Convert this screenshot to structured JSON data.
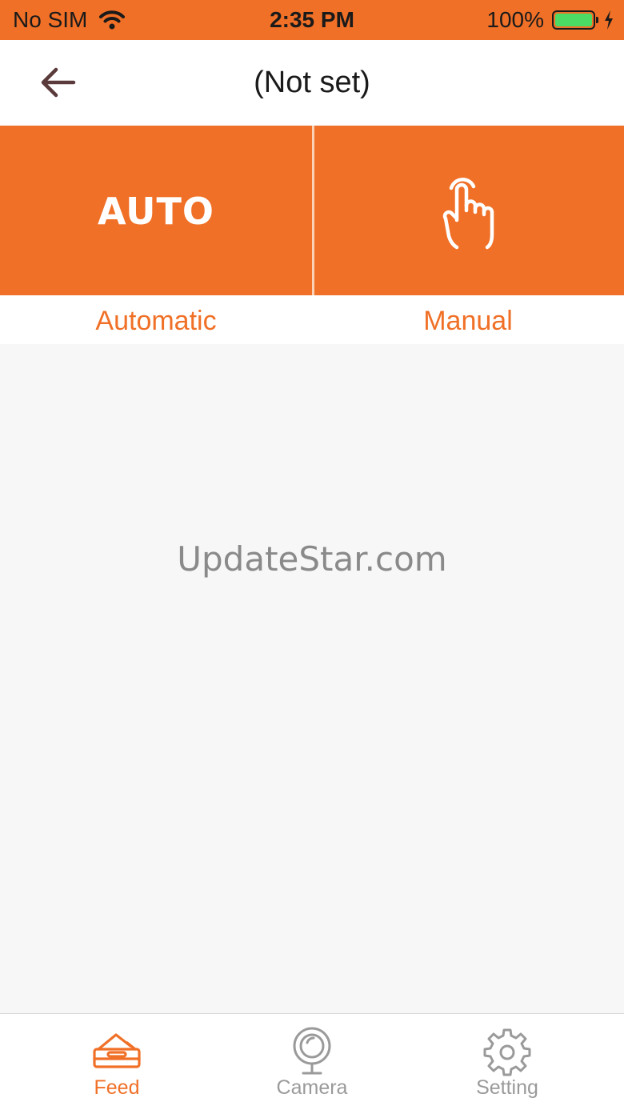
{
  "status_bar": {
    "carrier": "No SIM",
    "time": "2:35 PM",
    "battery": "100%",
    "battery_level": 1.0
  },
  "nav": {
    "title": "(Not set)",
    "back_icon": "arrow-left-icon"
  },
  "modes": {
    "auto_tile_text": "AUTO",
    "auto_label": "Automatic",
    "manual_label": "Manual",
    "manual_icon": "hand-pointer-icon"
  },
  "content": {
    "watermark": "UpdateStar.com"
  },
  "tabs": [
    {
      "label": "Feed",
      "icon": "feeder-icon",
      "active": true
    },
    {
      "label": "Camera",
      "icon": "webcam-icon",
      "active": false
    },
    {
      "label": "Setting",
      "icon": "gear-icon",
      "active": false
    }
  ],
  "colors": {
    "accent": "#f07027",
    "active_tab": "#f07027",
    "inactive_tab": "#9a9a9a",
    "battery": "#4cd964"
  }
}
